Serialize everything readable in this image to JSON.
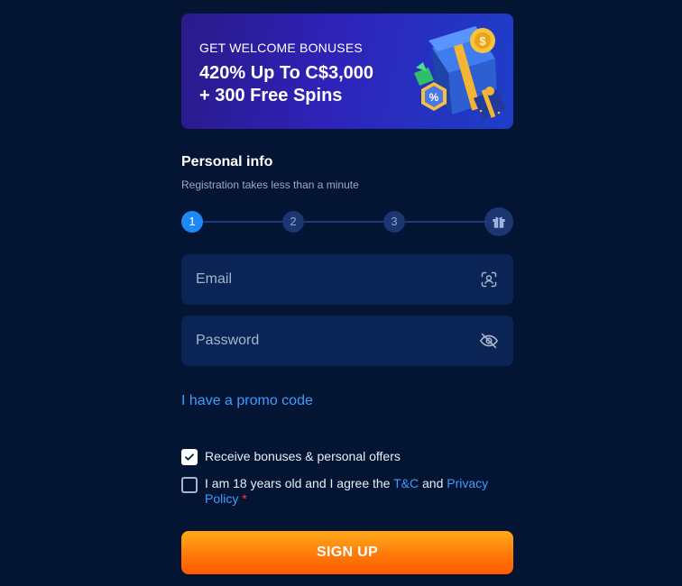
{
  "banner": {
    "kicker": "GET WELCOME BONUSES",
    "headline_line1": "420% Up To C$3,000",
    "headline_line2": "+ 300 Free Spins"
  },
  "personal_info": {
    "title": "Personal info",
    "subtitle": "Registration takes less than a minute"
  },
  "stepper": {
    "steps": [
      "1",
      "2",
      "3"
    ],
    "active_step": 1,
    "final_icon": "gift-icon"
  },
  "form": {
    "email_placeholder": "Email",
    "email_value": "",
    "email_icon": "face-scan-icon",
    "password_placeholder": "Password",
    "password_value": "",
    "password_icon": "eye-off-icon",
    "promo_link": "I have a promo code"
  },
  "consents": {
    "bonuses_label": "Receive bonuses & personal offers",
    "bonuses_checked": true,
    "age_text_prefix": "I am 18 years old and I agree the ",
    "tc_link": "T&C",
    "and_text": " and ",
    "privacy_link": "Privacy Policy",
    "required_marker": "*",
    "age_checked": false
  },
  "signup_button": "SIGN UP",
  "colors": {
    "background": "#041534",
    "field": "#0a2555",
    "link": "#3c9cff",
    "accent_step": "#1e88f5",
    "cta_top": "#ffaa1a",
    "cta_bottom": "#ff5a00"
  }
}
